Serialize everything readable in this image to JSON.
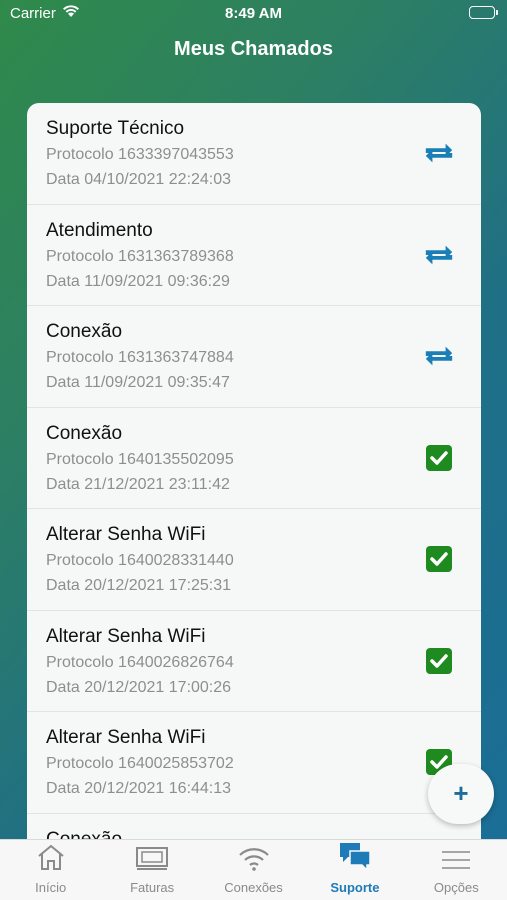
{
  "status_bar": {
    "carrier": "Carrier",
    "time": "8:49 AM"
  },
  "nav": {
    "title": "Meus Chamados"
  },
  "colors": {
    "accent": "#1f7bb8",
    "sync_icon": "#1a7fb6",
    "done_icon": "#1f8a1f"
  },
  "tickets": [
    {
      "title": "Suporte Técnico",
      "protocol": "Protocolo 1633397043553",
      "date": "Data 04/10/2021 22:24:03",
      "status_icon": "sync-icon"
    },
    {
      "title": "Atendimento",
      "protocol": "Protocolo 1631363789368",
      "date": "Data 11/09/2021 09:36:29",
      "status_icon": "sync-icon"
    },
    {
      "title": "Conexão",
      "protocol": "Protocolo 1631363747884",
      "date": "Data 11/09/2021 09:35:47",
      "status_icon": "sync-icon"
    },
    {
      "title": "Conexão",
      "protocol": "Protocolo 1640135502095",
      "date": "Data 21/12/2021 23:11:42",
      "status_icon": "checkbox-checked-icon"
    },
    {
      "title": "Alterar Senha WiFi",
      "protocol": "Protocolo 1640028331440",
      "date": "Data 20/12/2021 17:25:31",
      "status_icon": "checkbox-checked-icon"
    },
    {
      "title": "Alterar Senha WiFi",
      "protocol": "Protocolo 1640026826764",
      "date": "Data 20/12/2021 17:00:26",
      "status_icon": "checkbox-checked-icon"
    },
    {
      "title": "Alterar Senha WiFi",
      "protocol": "Protocolo 1640025853702",
      "date": "Data 20/12/2021 16:44:13",
      "status_icon": "checkbox-checked-icon"
    },
    {
      "title": "Conexão",
      "protocol": "",
      "date": "",
      "status_icon": ""
    }
  ],
  "fab": {
    "label": "+"
  },
  "tab_bar": {
    "items": [
      {
        "label": "Início",
        "icon": "house-icon"
      },
      {
        "label": "Faturas",
        "icon": "invoice-icon"
      },
      {
        "label": "Conexões",
        "icon": "wifi-icon"
      },
      {
        "label": "Suporte",
        "icon": "chat-bubbles-icon",
        "active": true
      },
      {
        "label": "Opções",
        "icon": "menu-icon"
      }
    ]
  }
}
